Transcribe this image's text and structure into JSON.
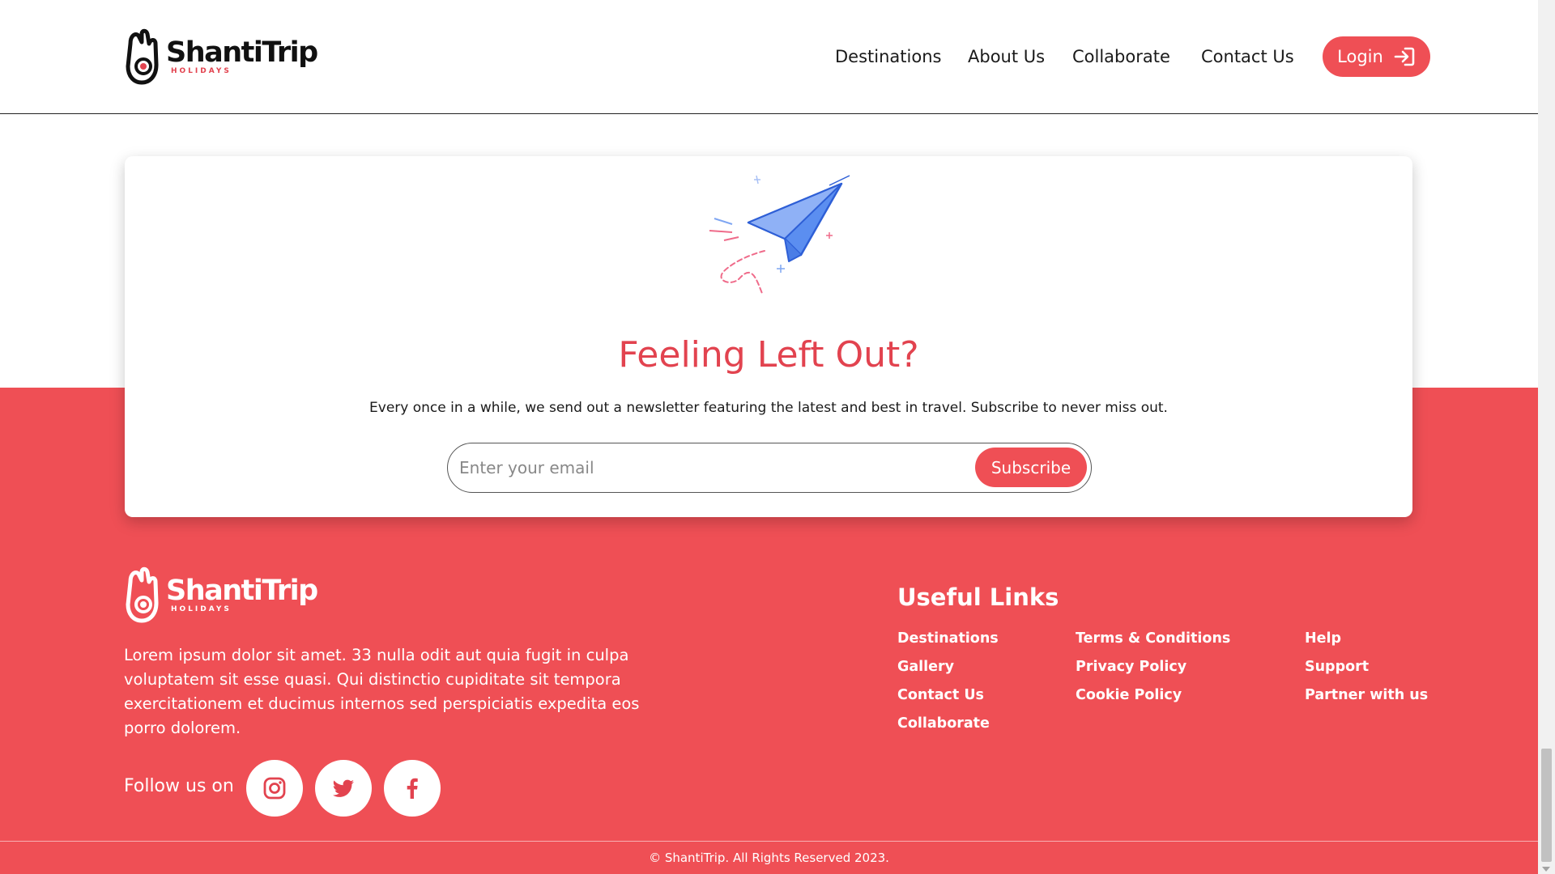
{
  "brand": {
    "name": "ShantiTrip",
    "tagline": "HOLIDAYS",
    "accent_color": "#ef4f55"
  },
  "header": {
    "nav": [
      {
        "label": "Destinations"
      },
      {
        "label": "About Us"
      },
      {
        "label": "Collaborate"
      },
      {
        "label": "Contact Us"
      }
    ],
    "login_label": "Login",
    "login_icon": "login-arrow-icon"
  },
  "newsletter": {
    "title": "Feeling Left Out?",
    "description": "Every once in a while, we send out a newsletter featuring the latest and best in travel. Subscribe to never miss out.",
    "email_placeholder": "Enter your email",
    "subscribe_label": "Subscribe",
    "illustration": "paper-plane"
  },
  "footer": {
    "about": "Lorem ipsum dolor sit amet. 33 nulla odit aut quia fugit in culpa voluptatem sit esse quasi. Qui distinctio cupiditate sit tempora exercitationem et ducimus internos sed perspiciatis expedita eos porro dolorem.",
    "follow_label": "Follow us on",
    "social": [
      "instagram-icon",
      "twitter-icon",
      "facebook-icon"
    ],
    "useful_links_title": "Useful Links",
    "links": {
      "col1": [
        "Destinations",
        "Gallery",
        "Contact Us",
        "Collaborate"
      ],
      "col2": [
        "Terms & Conditions",
        "Privacy Policy",
        "Cookie Policy"
      ],
      "col3": [
        "Help",
        "Support",
        "Partner with us"
      ]
    },
    "copyright": "© ShantiTrip. All Rights Reserved 2023."
  }
}
